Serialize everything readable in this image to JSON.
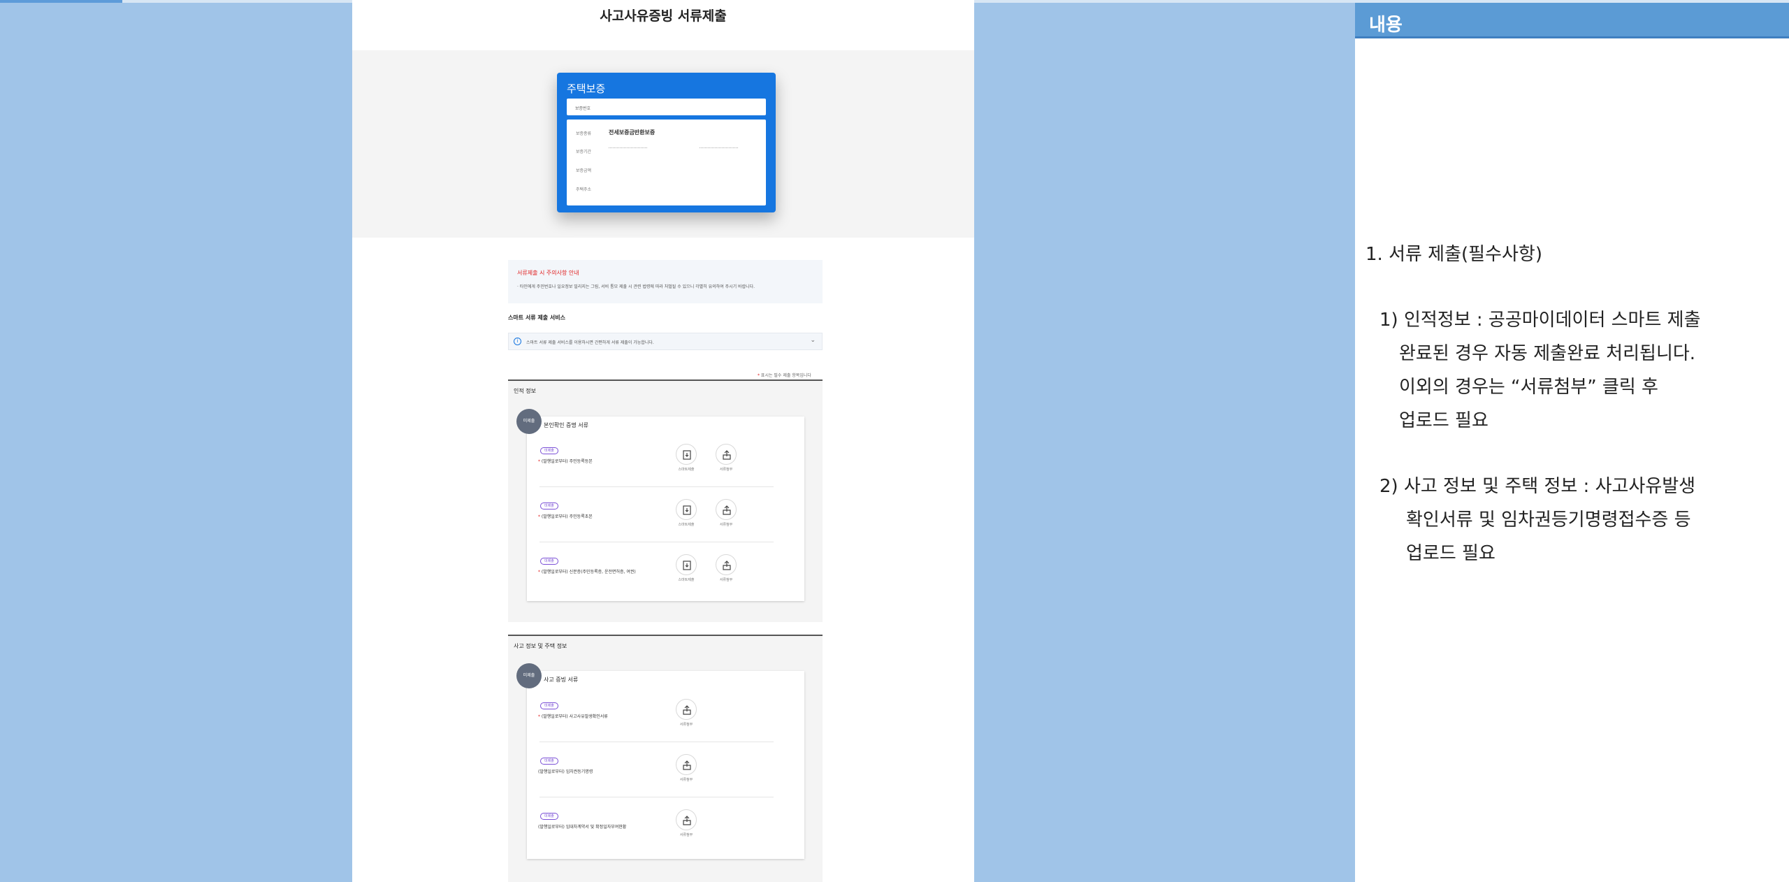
{
  "phone": {
    "title": "사고사유증빙 서류제출",
    "card": {
      "title": "주택보증",
      "field_text": "보증번호",
      "rows": [
        {
          "label": "보증종류",
          "value": "전세보증금반환보증"
        },
        {
          "label": "보증기간",
          "value": ""
        },
        {
          "label": "보증금액",
          "value": ""
        },
        {
          "label": "주택주소",
          "value": ""
        }
      ]
    },
    "notice": {
      "title": "서류제출 시 주의사항 안내",
      "text": "· 타인에게 주민번호나 일요정보 밀리지는 그림, 서비 통모 제출 시 관련 법령에 따라 처벌될 수 있으니 각별히 유의하여 주시기 바랍니다."
    },
    "smart_heading": "스마트 서류 제출 서비스",
    "smart_box_text": "스마트 서류 제출 서비스를 이용하시면 간편하게 서류 제출이 가능합니다.",
    "required_note": "표시는 필수 제출 항목입니다",
    "group1": {
      "title": "인적 정보",
      "badge": "미제출",
      "panel_title": "본인확인 증명 서류",
      "rows": [
        {
          "tag": "미제출",
          "label": "(발행일로부터) 주민등록등본",
          "required": true,
          "a1": "스마트제출",
          "a2": "서류첨부"
        },
        {
          "tag": "미제출",
          "label": "(발행일로부터) 주민등록초본",
          "required": true,
          "a1": "스마트제출",
          "a2": "서류첨부"
        },
        {
          "tag": "미제출",
          "label": "(발행일로부터) 신분증(주민등록증, 운전면허증, 여권)",
          "required": true,
          "a1": "스마트제출",
          "a2": "서류첨부"
        }
      ]
    },
    "group2": {
      "title": "사고 정보 및 주택 정보",
      "badge": "미제출",
      "panel_title": "사고 증빙 서류",
      "rows": [
        {
          "tag": "미제출",
          "label": "(발행일로부터) 사고사유발생확인서류",
          "required": true,
          "a2": "서류첨부"
        },
        {
          "tag": "미제출",
          "label": "(발행일로부터) 임차권등기명령",
          "required": false,
          "a2": "서류첨부"
        },
        {
          "tag": "미제출",
          "label": "(발행일로부터) 임대차계약서 및 확정일자부여현황",
          "required": false,
          "a2": "서류첨부"
        }
      ]
    }
  },
  "right": {
    "header": "내용",
    "lines": [
      "1. 서류 제출(필수사항)",
      "1) 인적정보 : 공공마이데이터 스마트 제출",
      "완료된 경우 자동 제출완료 처리됩니다.",
      "이외의 경우는 “서류첨부” 클릭 후",
      "업로드 필요",
      "2)  사고 정보 및 주택 정보 : 사고사유발생",
      "확인서류 및 임차권등기명령접수증 등",
      "업로드 필요"
    ]
  },
  "colors": {
    "background": "#a0c4e8",
    "card_blue": "#1676e0",
    "right_header": "#5b9bd5",
    "required_red": "#e02020",
    "tag_purple": "#7a4fd6"
  }
}
